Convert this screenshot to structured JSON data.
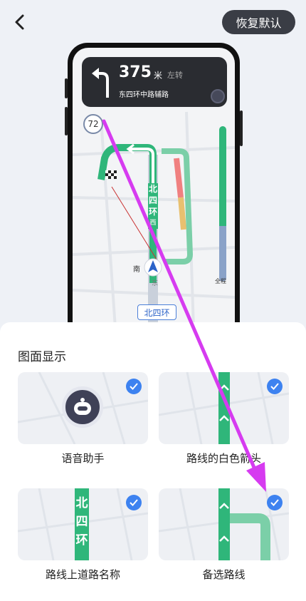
{
  "header": {
    "reset_label": "恢复默认"
  },
  "preview": {
    "distance": "375",
    "unit": "米",
    "direction": "左转",
    "road": "东四环中路辅路",
    "speed_limit": "72",
    "road_vertical": [
      "北",
      "四",
      "环"
    ],
    "road_badge": "北四环",
    "progress_label": "全程",
    "compass_south": "南",
    "compass_east": "东",
    "road_segment_west": "西"
  },
  "panel": {
    "title": "图面显示",
    "options": [
      {
        "label": "语音助手",
        "checked": true
      },
      {
        "label": "路线的白色箭头",
        "checked": true
      },
      {
        "label": "路线上道路名称",
        "checked": true,
        "road_chars": [
          "北",
          "四",
          "环"
        ]
      },
      {
        "label": "备选路线",
        "checked": true
      }
    ]
  },
  "colors": {
    "accent": "#3d82f0",
    "route_green": "#2fb67a",
    "annotation_arrow": "#d63bf0",
    "dark_button": "#3a3d45"
  }
}
